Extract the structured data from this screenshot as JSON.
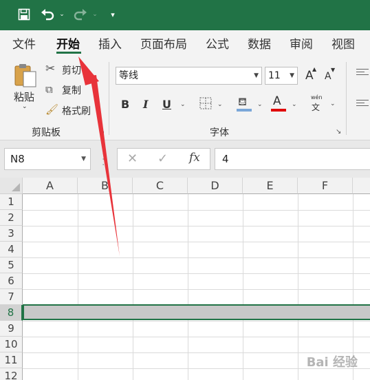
{
  "quick_access": {
    "undo_dropdown": "⌄",
    "redo_dropdown": "⌄",
    "customize": "▾"
  },
  "tabs": [
    {
      "label": "文件"
    },
    {
      "label": "开始"
    },
    {
      "label": "插入"
    },
    {
      "label": "页面布局"
    },
    {
      "label": "公式"
    },
    {
      "label": "数据"
    },
    {
      "label": "审阅"
    },
    {
      "label": "视图"
    }
  ],
  "active_tab": "开始",
  "clipboard": {
    "paste_label": "粘贴",
    "cut_label": "剪切",
    "copy_label": "复制",
    "format_painter_label": "格式刷",
    "group_label": "剪贴板"
  },
  "font": {
    "font_name": "等线",
    "font_size": "11",
    "grow_label": "A",
    "shrink_label": "A",
    "bold": "B",
    "italic": "I",
    "underline": "U",
    "font_color_label": "A",
    "phonetic_label": "wén",
    "phonetic_char": "文",
    "group_label": "字体"
  },
  "formula_bar": {
    "name_box": "N8",
    "fx_label": "fx",
    "value": "4"
  },
  "grid": {
    "columns": [
      "A",
      "B",
      "C",
      "D",
      "E",
      "F"
    ],
    "rows": [
      "1",
      "2",
      "3",
      "4",
      "5",
      "6",
      "7",
      "8",
      "9",
      "10",
      "11",
      "12"
    ],
    "selected_row": "8"
  },
  "watermark": "Bai 经验",
  "colors": {
    "accent": "#217346",
    "arrow": "#e8333a",
    "font_color_bar": "#e00000",
    "fill_color_bar": "#7aa7d8"
  }
}
